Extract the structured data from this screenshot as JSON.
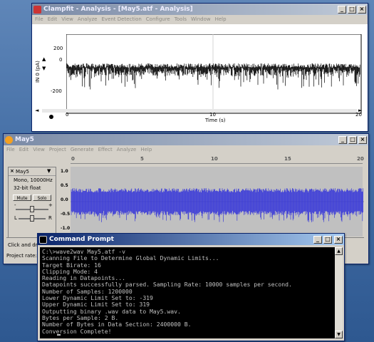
{
  "clampfit": {
    "title": "Clampfit - Analysis - [May5.atf - Analysis]",
    "menu": [
      "File",
      "Edit",
      "View",
      "Analyze",
      "Event Detection",
      "Configure",
      "Tools",
      "Window",
      "Help"
    ],
    "y_axis_label": "IN 0 (pA)",
    "y_ticks": [
      "200",
      "0",
      "-200"
    ],
    "x_ticks": [
      "0",
      "10",
      "20"
    ],
    "x_axis_label": "Time (s)"
  },
  "audacity": {
    "title": "May5",
    "menu": [
      "File",
      "Edit",
      "View",
      "Project",
      "Generate",
      "Effect",
      "Analyze",
      "Help"
    ],
    "ruler_ticks": [
      "0",
      "5",
      "10",
      "15",
      "20"
    ],
    "track": {
      "name": "May5",
      "info1": "Mono, 10000Hz",
      "info2": "32-bit float",
      "mute_label": "Mute",
      "solo_label": "Solo",
      "minus": "-",
      "plus": "+",
      "left": "L",
      "right": "R"
    },
    "scale": [
      "1.0",
      "0.5",
      "0.0",
      "-0.5",
      "-1.0"
    ],
    "status_hint": "Click and drag",
    "project_rate": "Project rate:"
  },
  "cmd": {
    "title": "Command Prompt",
    "lines": [
      "C:\\>wave2wav May5.atf -v",
      "Scanning File to Determine Global Dynamic Limits...",
      "Target Birate: 16",
      "Clipping Mode: 4",
      "Reading in Datapoints...",
      "Datapoints successfully parsed. Sampling Rate: 10000 samples per second.",
      "Number of Samples: 1200000",
      "Lower Dynamic Limit Set to: -319",
      "Upper Dynamic Limit Set to: 319",
      "Outputting binary .wav data to May5.wav.",
      "Bytes per Sample: 2 B.",
      "Number of Bytes in Data Section: 2400000 B.",
      "Conversion Complete!",
      "",
      "C:\\>"
    ]
  },
  "colors": {
    "desktop": "#3f6aa2",
    "title_active": "#0a246a",
    "trace": "#000000",
    "wave": "#3a3ad8"
  }
}
